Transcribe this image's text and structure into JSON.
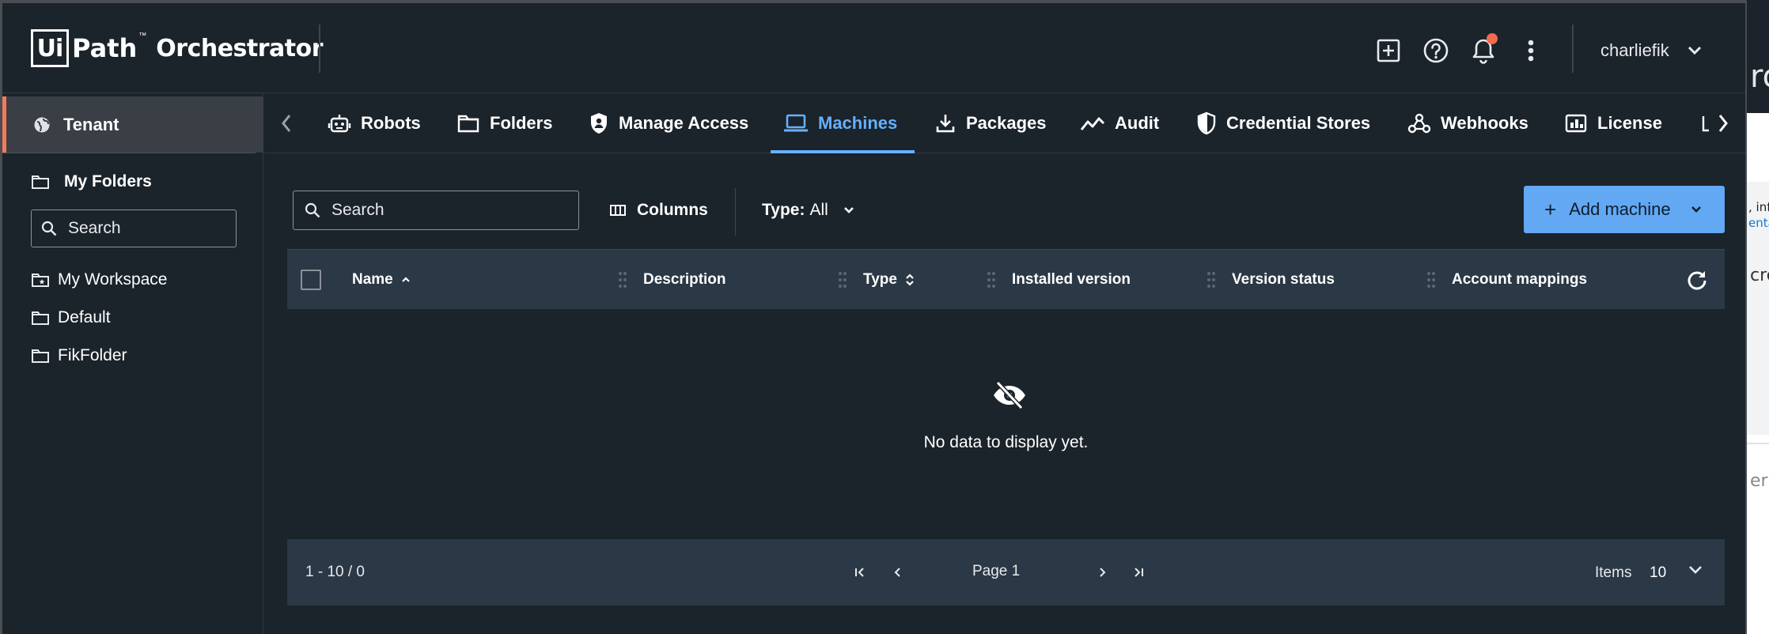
{
  "app": {
    "brand_ui": "Ui",
    "brand_path": "Path",
    "brand_tm": "™",
    "product": "Orchestrator",
    "user": "charliefik",
    "accent": "#66b0ff",
    "notification_color": "#f26b4c"
  },
  "header_icons": [
    "add-square-icon",
    "help-icon",
    "bell-icon",
    "more-vert-icon"
  ],
  "sidebar": {
    "tenant_label": "Tenant",
    "my_folders_label": "My Folders",
    "search_placeholder": "Search",
    "folders": [
      {
        "label": "My Workspace",
        "icon": "workspace-folder-icon"
      },
      {
        "label": "Default",
        "icon": "folder-icon"
      },
      {
        "label": "FikFolder",
        "icon": "folder-icon"
      }
    ]
  },
  "tabs": [
    {
      "label": "Robots",
      "icon": "robot-icon"
    },
    {
      "label": "Folders",
      "icon": "folder-icon"
    },
    {
      "label": "Manage Access",
      "icon": "shield-icon"
    },
    {
      "label": "Machines",
      "icon": "laptop-icon",
      "active": true
    },
    {
      "label": "Packages",
      "icon": "download-icon"
    },
    {
      "label": "Audit",
      "icon": "trend-icon"
    },
    {
      "label": "Credential Stores",
      "icon": "shield-icon"
    },
    {
      "label": "Webhooks",
      "icon": "webhook-icon"
    },
    {
      "label": "License",
      "icon": "license-icon"
    }
  ],
  "toolbar": {
    "search_placeholder": "Search",
    "columns_label": "Columns",
    "type_label": "Type:",
    "type_value": "All",
    "add_label": "Add machine",
    "add_color": "#62a8f3"
  },
  "grid": {
    "columns": [
      "Name",
      "Description",
      "Type",
      "Installed version",
      "Version status",
      "Account mappings"
    ],
    "sort": {
      "Name": "ascending",
      "Type": "sortable"
    },
    "empty_text": "No data to display yet."
  },
  "pager": {
    "range": "1 - 10 / 0",
    "page_label": "Page 1",
    "items_label": "Items",
    "items_value": "10"
  },
  "background_page": {
    "heading_fragment": "ro",
    "line1": ", info",
    "line2": "entati",
    "line3": "cree",
    "line4": "era"
  }
}
